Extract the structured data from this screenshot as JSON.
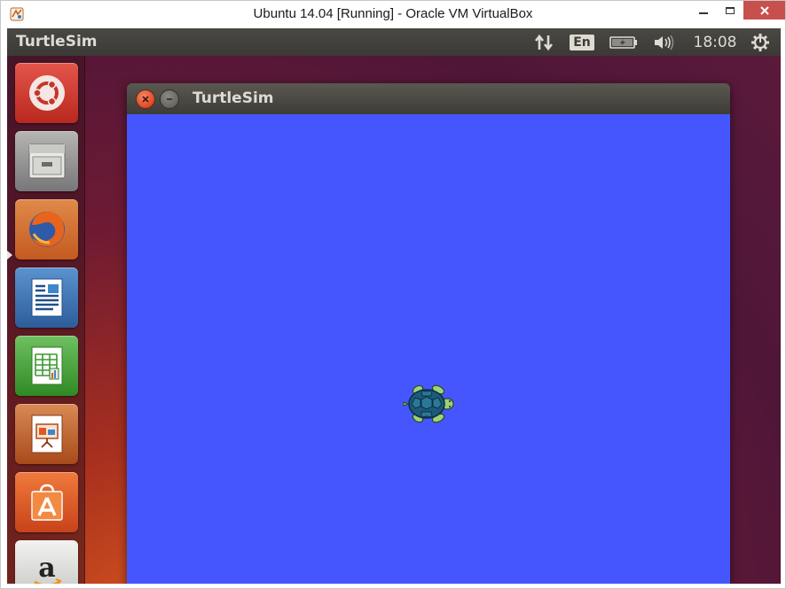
{
  "host_window": {
    "title": "Ubuntu 14.04 [Running] - Oracle VM VirtualBox",
    "app_icon": "virtualbox-icon",
    "controls": [
      "minimize-icon",
      "maximize-icon",
      "close-icon"
    ]
  },
  "top_panel": {
    "app_name": "TurtleSim",
    "tray": {
      "network_icon": "network-updown-icon",
      "keyboard_layout": "En",
      "battery_icon": "battery-icon",
      "volume_icon": "volume-icon",
      "clock": "18:08",
      "session_icon": "power-gear-icon"
    }
  },
  "launcher": {
    "items": [
      {
        "name": "dash-home",
        "icon": "ubuntu-logo-icon",
        "color": "#c7342b"
      },
      {
        "name": "files",
        "icon": "file-cabinet-icon",
        "color": "#8a8a86"
      },
      {
        "name": "firefox",
        "icon": "firefox-icon",
        "color": "#d9571f",
        "active": true
      },
      {
        "name": "libreoffice-writer",
        "icon": "writer-document-icon",
        "color": "#2f6fb3"
      },
      {
        "name": "libreoffice-calc",
        "icon": "calc-spreadsheet-icon",
        "color": "#3a9a2f"
      },
      {
        "name": "libreoffice-impress",
        "icon": "impress-presentation-icon",
        "color": "#b8521f"
      },
      {
        "name": "software-center",
        "icon": "shopping-bag-icon",
        "color": "#e2571e"
      },
      {
        "name": "amazon",
        "icon": "amazon-icon",
        "color": "#d8d8d6"
      }
    ]
  },
  "turtlesim_window": {
    "title": "TurtleSim",
    "background_color": "#4556ff",
    "turtle_icon": "turtle-icon"
  }
}
